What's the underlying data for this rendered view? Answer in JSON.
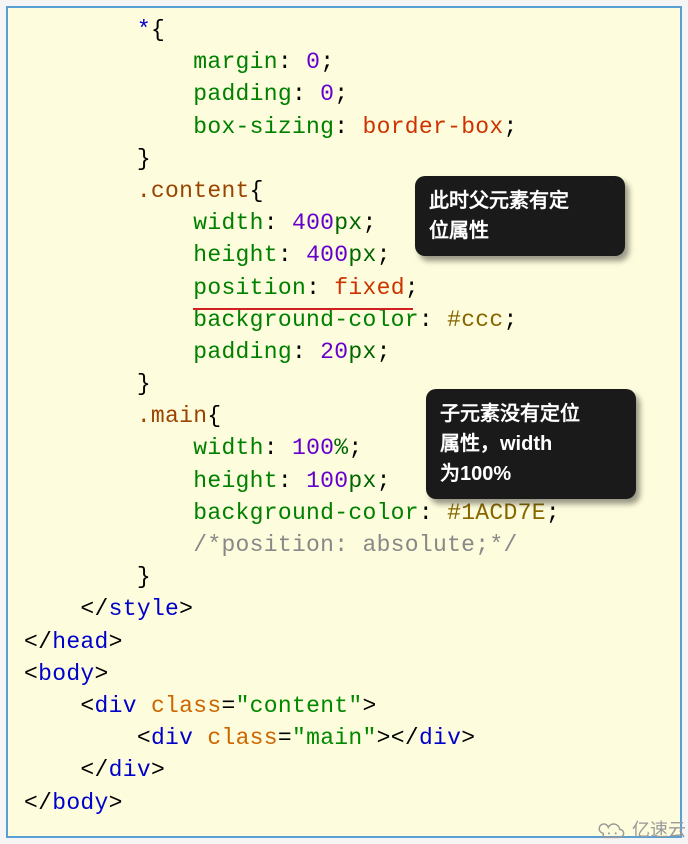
{
  "code": {
    "line1_star": "*",
    "line1_brace": "{",
    "margin_prop": "margin",
    "margin_val": "0",
    "padding_prop": "padding",
    "padding_val": "0",
    "boxsizing_prop": "box-sizing",
    "boxsizing_val": "border-box",
    "close_brace": "}",
    "content_sel": ".content",
    "open_brace": "{",
    "width_prop": "width",
    "width_400": "400",
    "px": "px",
    "height_prop": "height",
    "height_400": "400",
    "position_prop": "position",
    "position_fixed": "fixed",
    "bgcolor_prop": "background-color",
    "bgcolor_ccc": "#ccc",
    "padding_20": "20",
    "main_sel": ".main",
    "width_100pct": "100",
    "pct": "%",
    "height_100": "100",
    "bgcolor_1acd7e": "#1ACD7E",
    "comment_pos": "/*position: absolute;*/",
    "style_close": "style",
    "head_close": "head",
    "body_open": "body",
    "div_tag": "div",
    "class_attr": "class",
    "eq": "=",
    "content_str": "\"content\"",
    "main_str": "\"main\"",
    "body_close": "body",
    "lt": "<",
    "gt": ">",
    "slash": "/",
    "colon": ":",
    "semi": ";"
  },
  "tooltips": {
    "t1_line1": "此时父元素有定",
    "t1_line2": "位属性",
    "t2_line1": "子元素没有定位",
    "t2_line2": "属性，width",
    "t2_line3": "为100%"
  },
  "watermark": {
    "text": "亿速云"
  }
}
